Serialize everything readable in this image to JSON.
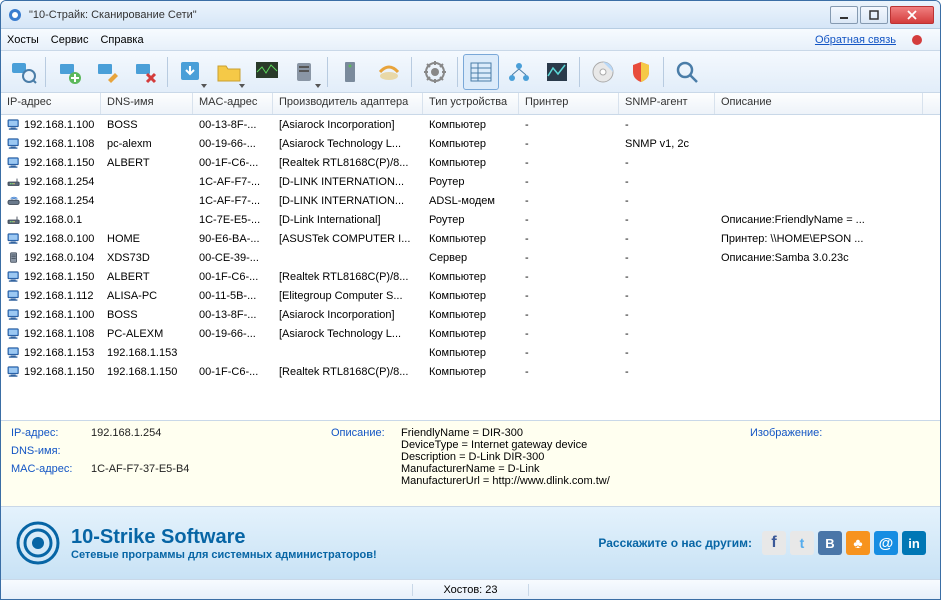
{
  "title": "\"10-Страйк: Сканирование Сети\"",
  "menu": {
    "hosts": "Хосты",
    "service": "Сервис",
    "help": "Справка",
    "feedback": "Обратная связь"
  },
  "columns": [
    "IP-адрес",
    "DNS-имя",
    "MAC-адрес",
    "Производитель адаптера",
    "Тип устройства",
    "Принтер",
    "SNMP-агент",
    "Описание"
  ],
  "rows": [
    {
      "icon": "pc",
      "ip": "192.168.1.100",
      "dns": "BOSS",
      "mac": "00-13-8F-...",
      "vendor": "[Asiarock Incorporation]",
      "type": "Компьютер",
      "printer": "-",
      "snmp": "-",
      "desc": ""
    },
    {
      "icon": "pc",
      "ip": "192.168.1.108",
      "dns": "pc-alexm",
      "mac": "00-19-66-...",
      "vendor": "[Asiarock Technology L...",
      "type": "Компьютер",
      "printer": "-",
      "snmp": "SNMP v1, 2c",
      "desc": ""
    },
    {
      "icon": "pc",
      "ip": "192.168.1.150",
      "dns": "ALBERT",
      "mac": "00-1F-C6-...",
      "vendor": "[Realtek RTL8168C(P)/8...",
      "type": "Компьютер",
      "printer": "-",
      "snmp": "-",
      "desc": ""
    },
    {
      "icon": "router",
      "ip": "192.168.1.254",
      "dns": "",
      "mac": "1C-AF-F7-...",
      "vendor": "[D-LINK INTERNATION...",
      "type": "Роутер",
      "printer": "-",
      "snmp": "-",
      "desc": ""
    },
    {
      "icon": "modem",
      "ip": "192.168.1.254",
      "dns": "",
      "mac": "1C-AF-F7-...",
      "vendor": "[D-LINK INTERNATION...",
      "type": "ADSL-модем",
      "printer": "-",
      "snmp": "-",
      "desc": ""
    },
    {
      "icon": "router",
      "ip": "192.168.0.1",
      "dns": "",
      "mac": "1C-7E-E5-...",
      "vendor": "[D-Link International]",
      "type": "Роутер",
      "printer": "-",
      "snmp": "-",
      "desc": "Описание:FriendlyName = ..."
    },
    {
      "icon": "pc",
      "ip": "192.168.0.100",
      "dns": "HOME",
      "mac": "90-E6-BA-...",
      "vendor": "[ASUSTek COMPUTER I...",
      "type": "Компьютер",
      "printer": "-",
      "snmp": "-",
      "desc": "Принтер: \\\\HOME\\EPSON ..."
    },
    {
      "icon": "server",
      "ip": "192.168.0.104",
      "dns": "XDS73D",
      "mac": "00-CE-39-...",
      "vendor": "",
      "type": "Сервер",
      "printer": "-",
      "snmp": "-",
      "desc": "Описание:Samba 3.0.23c"
    },
    {
      "icon": "pc",
      "ip": "192.168.1.150",
      "dns": "ALBERT",
      "mac": "00-1F-C6-...",
      "vendor": "[Realtek RTL8168C(P)/8...",
      "type": "Компьютер",
      "printer": "-",
      "snmp": "-",
      "desc": ""
    },
    {
      "icon": "pc",
      "ip": "192.168.1.112",
      "dns": "ALISA-PC",
      "mac": "00-11-5B-...",
      "vendor": "[Elitegroup Computer S...",
      "type": "Компьютер",
      "printer": "-",
      "snmp": "-",
      "desc": ""
    },
    {
      "icon": "pc",
      "ip": "192.168.1.100",
      "dns": "BOSS",
      "mac": "00-13-8F-...",
      "vendor": "[Asiarock Incorporation]",
      "type": "Компьютер",
      "printer": "-",
      "snmp": "-",
      "desc": ""
    },
    {
      "icon": "pc",
      "ip": "192.168.1.108",
      "dns": "PC-ALEXM",
      "mac": "00-19-66-...",
      "vendor": "[Asiarock Technology L...",
      "type": "Компьютер",
      "printer": "-",
      "snmp": "-",
      "desc": ""
    },
    {
      "icon": "pc",
      "ip": "192.168.1.153",
      "dns": "192.168.1.153",
      "mac": "",
      "vendor": "",
      "type": "Компьютер",
      "printer": "-",
      "snmp": "-",
      "desc": ""
    },
    {
      "icon": "pc",
      "ip": "192.168.1.150",
      "dns": "192.168.1.150",
      "mac": "00-1F-C6-...",
      "vendor": "[Realtek RTL8168C(P)/8...",
      "type": "Компьютер",
      "printer": "-",
      "snmp": "-",
      "desc": ""
    }
  ],
  "detail": {
    "ip_lbl": "IP-адрес:",
    "ip": "192.168.1.254",
    "dns_lbl": "DNS-имя:",
    "dns": "",
    "mac_lbl": "MAC-адрес:",
    "mac": "1C-AF-F7-37-E5-B4",
    "desc_lbl": "Описание:",
    "lines": [
      "FriendlyName = DIR-300",
      "DeviceType = Internet gateway device",
      "Description = D-Link DIR-300",
      "ManufacturerName = D-Link",
      "ManufacturerUrl = http://www.dlink.com.tw/"
    ],
    "img_lbl": "Изображение:"
  },
  "banner": {
    "t1": "10-Strike Software",
    "t2": "Сетевые программы для системных администраторов!",
    "share": "Расскажите о нас другим:"
  },
  "status": "Хостов: 23"
}
